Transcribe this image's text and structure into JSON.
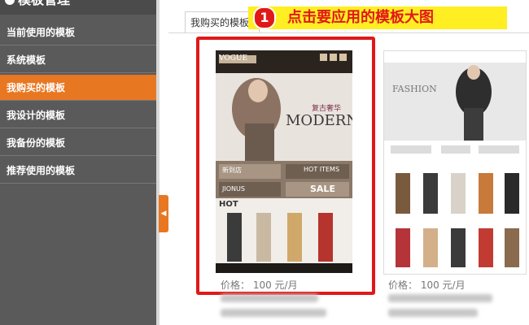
{
  "sidebar": {
    "title": "模板管理",
    "items": [
      {
        "label": "当前使用的模板",
        "active": false
      },
      {
        "label": "系统模板",
        "active": false
      },
      {
        "label": "我购买的模板",
        "active": true
      },
      {
        "label": "我设计的模板",
        "active": false
      },
      {
        "label": "我备份的模板",
        "active": false
      },
      {
        "label": "推荐使用的模板",
        "active": false
      }
    ]
  },
  "tab": {
    "label": "我购买的模板"
  },
  "callout": {
    "number": "1",
    "text": "点击要应用的模板大图"
  },
  "templates": [
    {
      "brand": "VOGUE",
      "headline": "MODERN",
      "tagline": "复古奢华",
      "panel_new": "新到店",
      "panel_hot_items": "HOT ITEMS",
      "panel_sale": "SALE",
      "panel_jionus": "JIONUS",
      "panel_hot": "HOT",
      "price": "价格： 100 元/月"
    },
    {
      "brand": "FASHION",
      "price": "价格： 100 元/月"
    }
  ],
  "colors": {
    "accent": "#e87722",
    "callout_bg": "#ffee22",
    "highlight": "#e11818",
    "sidebar": "#5a5a5a"
  }
}
